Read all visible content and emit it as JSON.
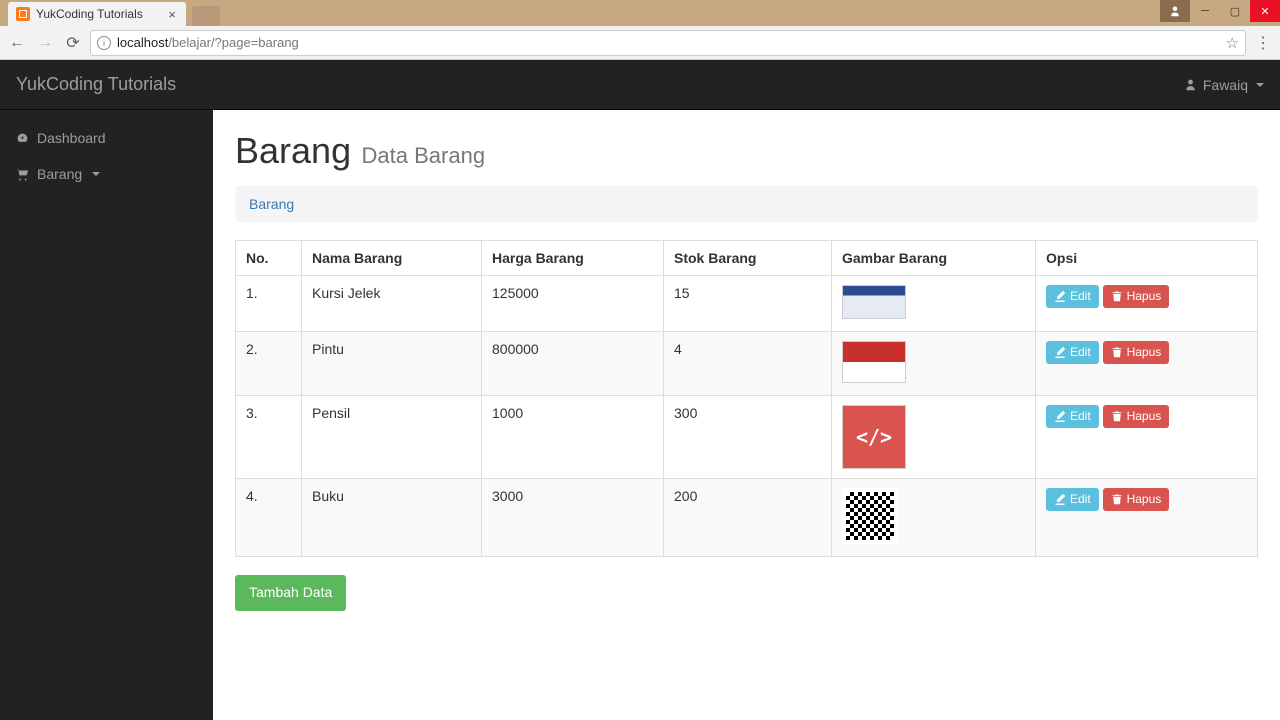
{
  "browser": {
    "tab_title": "YukCoding Tutorials",
    "url_host": "localhost",
    "url_path": "/belajar/?page=barang"
  },
  "topbar": {
    "brand": "YukCoding Tutorials",
    "user": "Fawaiq"
  },
  "sidebar": {
    "items": [
      {
        "label": "Dashboard",
        "icon": "dashboard-icon",
        "has_caret": false
      },
      {
        "label": "Barang",
        "icon": "cart-icon",
        "has_caret": true
      }
    ]
  },
  "page": {
    "title": "Barang",
    "subtitle": "Data Barang",
    "breadcrumb": "Barang"
  },
  "table": {
    "headers": {
      "no": "No.",
      "nama": "Nama Barang",
      "harga": "Harga Barang",
      "stok": "Stok Barang",
      "gambar": "Gambar Barang",
      "opsi": "Opsi"
    },
    "rows": [
      {
        "no": "1.",
        "nama": "Kursi Jelek",
        "harga": "125000",
        "stok": "15",
        "thumb": "t1"
      },
      {
        "no": "2.",
        "nama": "Pintu",
        "harga": "800000",
        "stok": "4",
        "thumb": "t2"
      },
      {
        "no": "3.",
        "nama": "Pensil",
        "harga": "1000",
        "stok": "300",
        "thumb": "t3"
      },
      {
        "no": "4.",
        "nama": "Buku",
        "harga": "3000",
        "stok": "200",
        "thumb": "t4"
      }
    ]
  },
  "buttons": {
    "edit": "Edit",
    "hapus": "Hapus",
    "tambah": "Tambah Data"
  }
}
